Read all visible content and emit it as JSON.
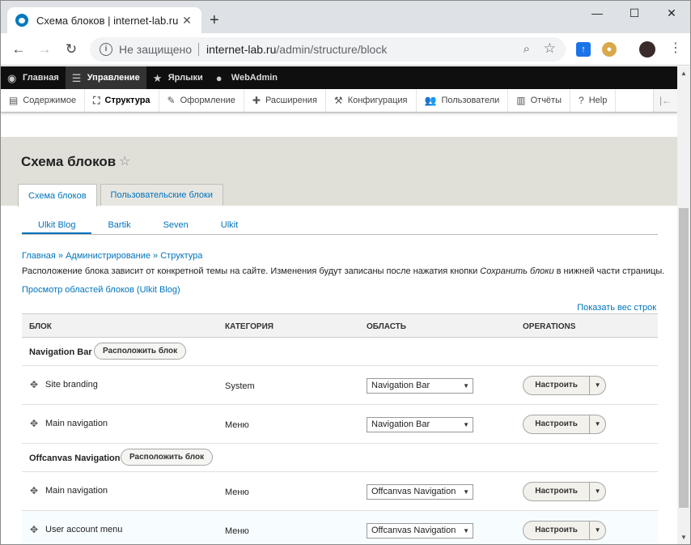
{
  "browser": {
    "tab_title": "Схема блоков | internet-lab.ru",
    "tab_close": "✕",
    "new_tab": "+",
    "security_label": "Не защищено",
    "url_host": "internet-lab.ru",
    "url_path": "/admin/structure/block",
    "window_controls": [
      "—",
      "☐",
      "✕"
    ]
  },
  "toolbar": {
    "items": [
      {
        "label": "Главная",
        "icon": "drupal-icon"
      },
      {
        "label": "Управление",
        "icon": "menu-icon"
      },
      {
        "label": "Ярлыки",
        "icon": "star-icon"
      },
      {
        "label": "WebAdmin",
        "icon": "user-icon"
      }
    ],
    "tray": [
      {
        "label": "Содержимое",
        "icon": "content-icon"
      },
      {
        "label": "Структура",
        "icon": "structure-icon"
      },
      {
        "label": "Оформление",
        "icon": "brush-icon"
      },
      {
        "label": "Расширения",
        "icon": "puzzle-icon"
      },
      {
        "label": "Конфигурация",
        "icon": "wrench-icon"
      },
      {
        "label": "Пользователи",
        "icon": "people-icon"
      },
      {
        "label": "Отчёты",
        "icon": "reports-icon"
      },
      {
        "label": "Help",
        "icon": "help-icon"
      }
    ]
  },
  "page": {
    "title": "Схема блоков",
    "primary_tabs": [
      "Схема блоков",
      "Пользовательские блоки"
    ],
    "secondary_tabs": [
      "Ulkit Blog",
      "Bartik",
      "Seven",
      "Ulkit"
    ],
    "breadcrumb": "Главная » Администрирование » Структура",
    "description_before": "Расположение блока зависит от конкретной темы на сайте. Изменения будут записаны после нажатия кнопки ",
    "description_em": "Сохранить блоки",
    "description_after": " в нижней части страницы.",
    "demo_link": "Просмотр областей блоков (Ulkit Blog)",
    "show_weights": "Показать вес строк"
  },
  "table": {
    "headers": [
      "БЛОК",
      "КАТЕГОРИЯ",
      "ОБЛАСТЬ",
      "OPERATIONS"
    ],
    "place_label": "Расположить блок",
    "configure_label": "Настроить",
    "regions": [
      {
        "name": "Navigation Bar",
        "blocks": [
          {
            "name": "Site branding",
            "category": "System",
            "region": "Navigation Bar"
          },
          {
            "name": "Main navigation",
            "category": "Меню",
            "region": "Navigation Bar"
          }
        ]
      },
      {
        "name": "Offcanvas Navigation",
        "blocks": [
          {
            "name": "Main navigation",
            "category": "Меню",
            "region": "Offcanvas Navigation"
          },
          {
            "name": "User account menu",
            "category": "Меню",
            "region": "Offcanvas Navigation"
          }
        ]
      }
    ]
  }
}
